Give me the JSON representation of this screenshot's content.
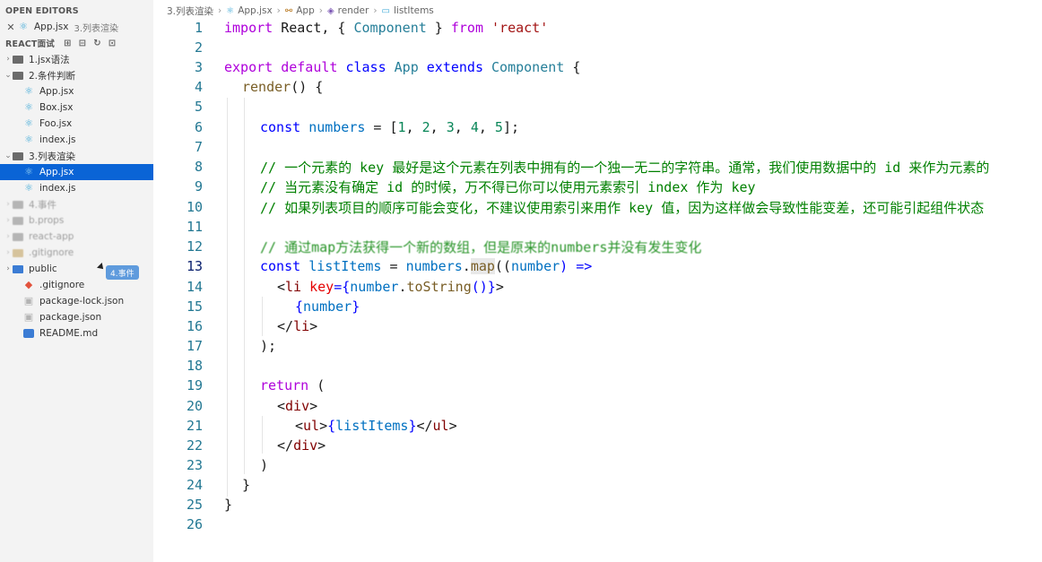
{
  "sidebar": {
    "open_editors": {
      "title": "OPEN EDITORS",
      "file": "App.jsx",
      "folder": "3.列表渲染"
    },
    "project": {
      "title": "REACT面试",
      "actions": [
        "new-file-icon",
        "new-folder-icon",
        "refresh-icon",
        "collapse-icon"
      ]
    },
    "tree": [
      {
        "label": "1.jsx语法",
        "type": "folder",
        "expanded": false
      },
      {
        "label": "2.条件判断",
        "type": "folder",
        "expanded": true
      },
      {
        "label": "App.jsx",
        "type": "react"
      },
      {
        "label": "Box.jsx",
        "type": "react"
      },
      {
        "label": "Foo.jsx",
        "type": "react"
      },
      {
        "label": "index.js",
        "type": "react"
      },
      {
        "label": "3.列表渲染",
        "type": "folder",
        "expanded": true
      },
      {
        "label": "App.jsx",
        "type": "react",
        "selected": true
      },
      {
        "label": "index.js",
        "type": "react"
      },
      {
        "label": "4.事件",
        "type": "folder"
      },
      {
        "label": "b.props",
        "type": "folder"
      },
      {
        "label": "react-app",
        "type": "folder"
      },
      {
        "label": ".gitignore",
        "type": "folder"
      },
      {
        "label": "public",
        "type": "folder"
      },
      {
        "label": ".gitignore",
        "type": "git"
      },
      {
        "label": "package-lock.json",
        "type": "json"
      },
      {
        "label": "package.json",
        "type": "json"
      },
      {
        "label": "README.md",
        "type": "md"
      }
    ],
    "tooltip": "4.事件"
  },
  "breadcrumb": {
    "folder": "3.列表渲染",
    "file": "App.jsx",
    "class": "App",
    "method": "render",
    "symbol": "listItems"
  },
  "editor": {
    "active_line": 13,
    "lines": [
      {
        "n": "1"
      },
      {
        "n": "2"
      },
      {
        "n": "3"
      },
      {
        "n": "4"
      },
      {
        "n": "5"
      },
      {
        "n": "6"
      },
      {
        "n": "7"
      },
      {
        "n": "8"
      },
      {
        "n": "9"
      },
      {
        "n": "10"
      },
      {
        "n": "11"
      },
      {
        "n": "12"
      },
      {
        "n": "13"
      },
      {
        "n": "14"
      },
      {
        "n": "15"
      },
      {
        "n": "16"
      },
      {
        "n": "17"
      },
      {
        "n": "18"
      },
      {
        "n": "19"
      },
      {
        "n": "20"
      },
      {
        "n": "21"
      },
      {
        "n": "22"
      },
      {
        "n": "23"
      },
      {
        "n": "24"
      },
      {
        "n": "25"
      },
      {
        "n": "26"
      }
    ],
    "code": {
      "l1": [
        "import",
        " React, { ",
        "Component",
        " } ",
        "from",
        " ",
        "'react'"
      ],
      "l3": [
        "export",
        " ",
        "default",
        " ",
        "class",
        " ",
        "App",
        " ",
        "extends",
        " ",
        "Component",
        " {"
      ],
      "l4": [
        "render",
        "() {"
      ],
      "l6": [
        "const",
        " ",
        "numbers",
        " = [",
        "1",
        ", ",
        "2",
        ", ",
        "3",
        ", ",
        "4",
        ", ",
        "5",
        "];"
      ],
      "l8": "// 一个元素的 key 最好是这个元素在列表中拥有的一个独一无二的字符串。通常，我们使用数据中的 id 来作为元素的",
      "l9": "// 当元素没有确定 id 的时候，万不得已你可以使用元素索引 index 作为 key",
      "l10": "// 如果列表项目的顺序可能会变化，不建议使用索引来用作 key 值，因为这样做会导致性能变差，还可能引起组件状态",
      "l12": "// 通过map方法获得一个新的数组，但是原来的numbers并没有发生变化",
      "l13": [
        "const",
        " ",
        "listItems",
        " = ",
        "numbers",
        ".",
        "map",
        "((",
        "number",
        ") =>"
      ],
      "l14": [
        "<",
        "li",
        " ",
        "key",
        "={",
        "number",
        ".",
        "toString",
        "()}",
        ">"
      ],
      "l15": [
        "{",
        "number",
        "}"
      ],
      "l16": [
        "</",
        "li",
        ">"
      ],
      "l17": ");",
      "l19": [
        "return",
        " ("
      ],
      "l20": [
        "<",
        "div",
        ">"
      ],
      "l21": [
        "<",
        "ul",
        ">",
        "{",
        "listItems",
        "}",
        "</",
        "ul",
        ">"
      ],
      "l22": [
        "</",
        "div",
        ">"
      ],
      "l23": ")",
      "l24": "}",
      "l25": "}"
    }
  }
}
